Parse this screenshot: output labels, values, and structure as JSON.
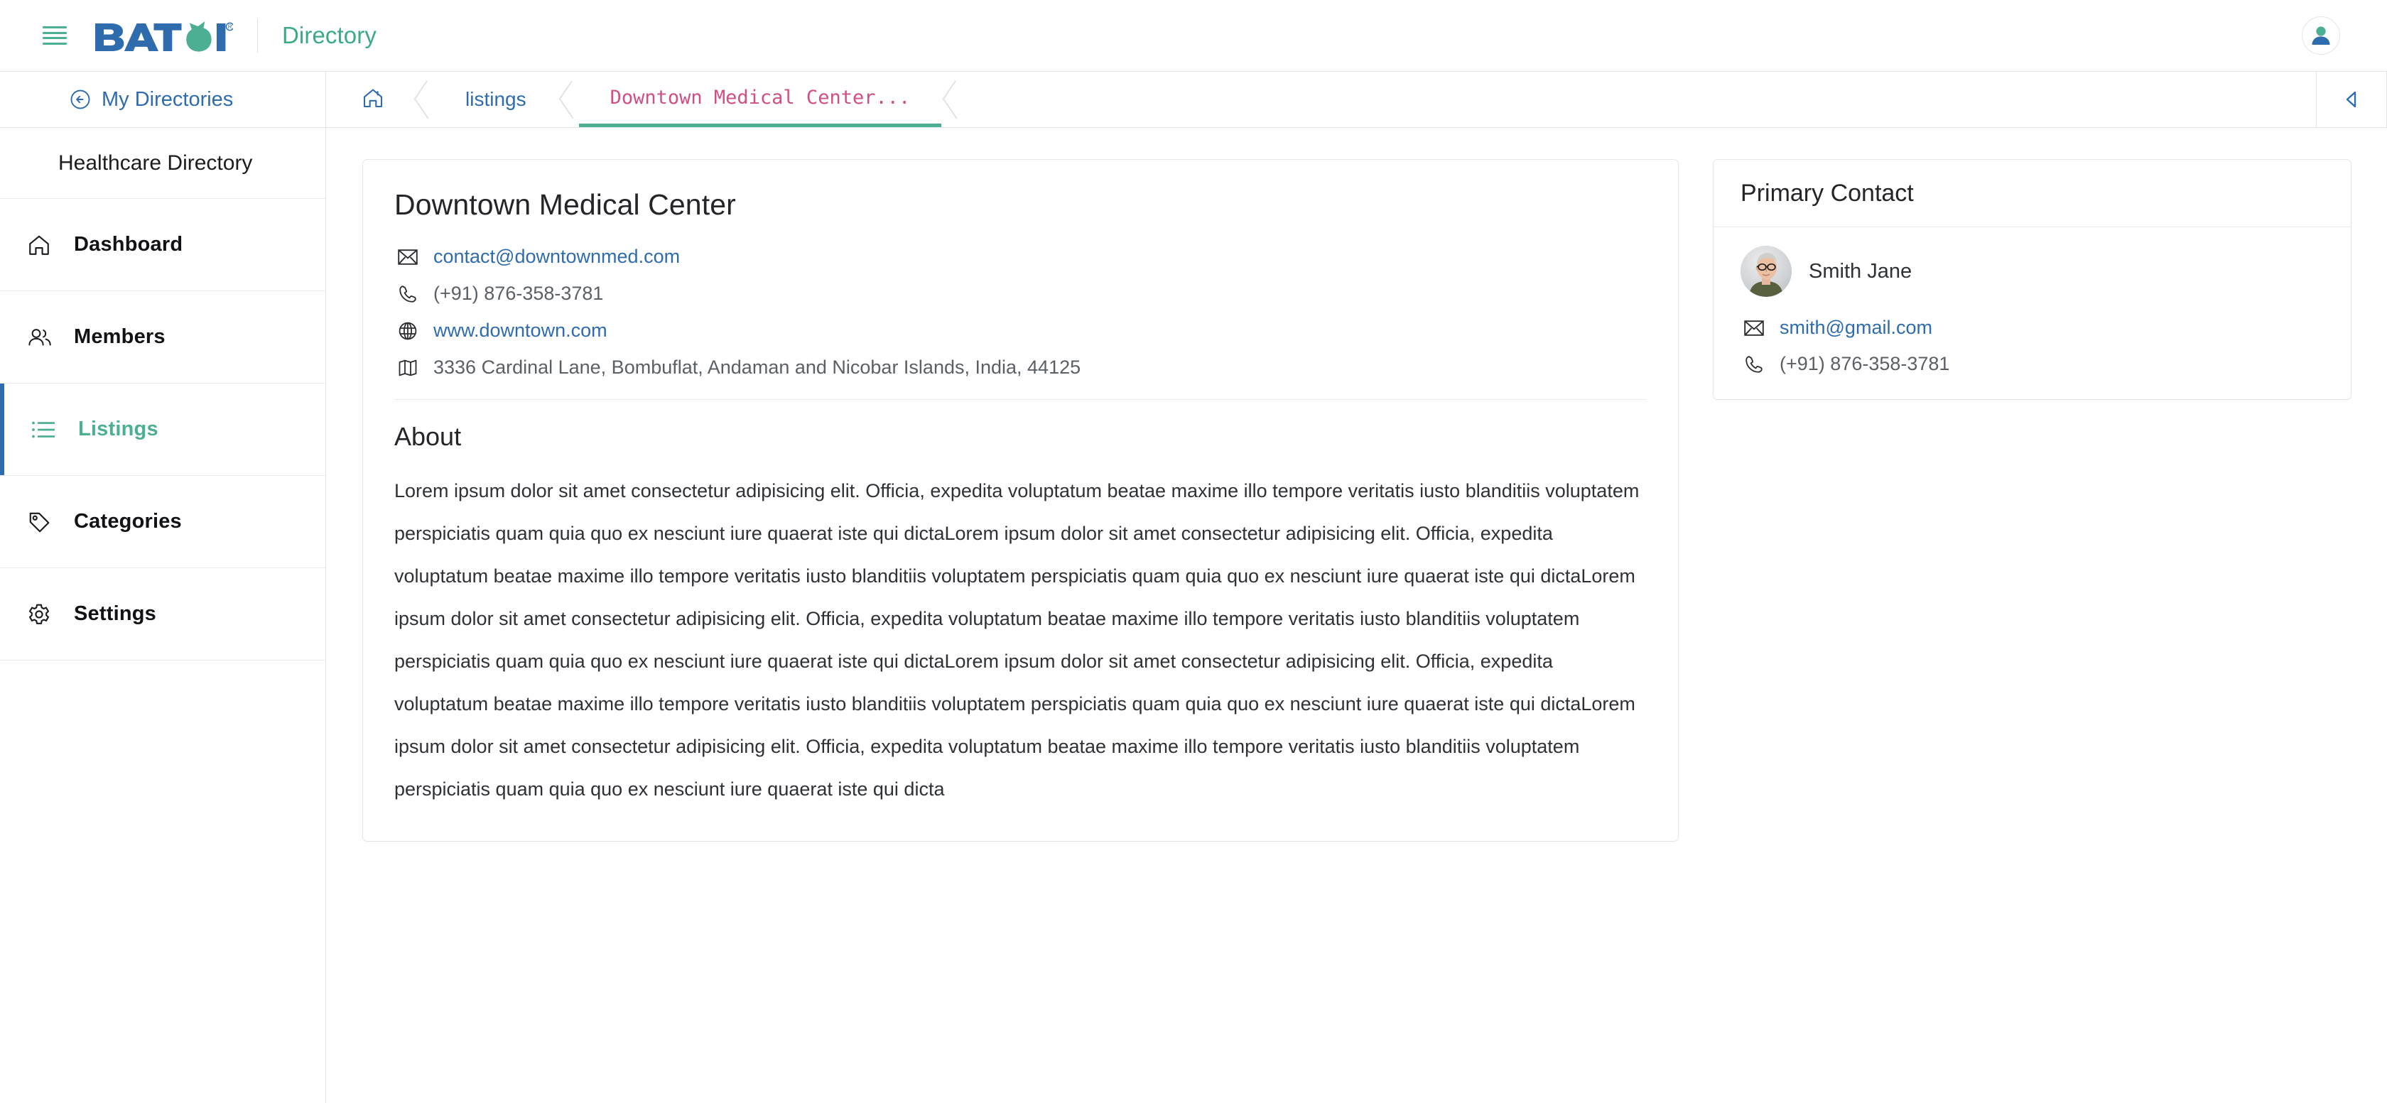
{
  "topbar": {
    "menu_icon": "hamburger-icon",
    "logo_text": "BATOI",
    "logo_trademark": "®",
    "app_name": "Directory",
    "user_icon": "user-avatar-icon"
  },
  "breadcrumb_bar": {
    "back_link": {
      "label": "My Directories",
      "icon": "circle-arrow-left-icon"
    },
    "items": [
      {
        "label": "",
        "icon": "home-icon",
        "active": false
      },
      {
        "label": "listings",
        "icon": "",
        "active": false
      },
      {
        "label": "Downtown Medical Center...",
        "icon": "",
        "active": true
      }
    ],
    "collapse_button_icon": "caret-left-icon"
  },
  "sidebar": {
    "directory_title": "Healthcare Directory",
    "items": [
      {
        "label": "Dashboard",
        "icon": "home-icon",
        "active": false
      },
      {
        "label": "Members",
        "icon": "users-icon",
        "active": false
      },
      {
        "label": "Listings",
        "icon": "list-icon",
        "active": true
      },
      {
        "label": "Categories",
        "icon": "tag-icon",
        "active": false
      },
      {
        "label": "Settings",
        "icon": "gear-icon",
        "active": false
      }
    ]
  },
  "listing": {
    "title": "Downtown Medical Center",
    "email": "contact@downtownmed.com",
    "phone": "(+91) 876-358-3781",
    "website": "www.downtown.com",
    "address": "3336 Cardinal Lane, Bombuflat, Andaman and Nicobar Islands, India, 44125",
    "about_heading": "About",
    "about_text": "Lorem ipsum dolor sit amet consectetur adipisicing elit. Officia, expedita voluptatum beatae maxime illo tempore veritatis iusto blanditiis voluptatem perspiciatis quam quia quo ex nesciunt iure quaerat iste qui dictaLorem ipsum dolor sit amet consectetur adipisicing elit. Officia, expedita voluptatum beatae maxime illo tempore veritatis iusto blanditiis voluptatem perspiciatis quam quia quo ex nesciunt iure quaerat iste qui dictaLorem ipsum dolor sit amet consectetur adipisicing elit. Officia, expedita voluptatum beatae maxime illo tempore veritatis iusto blanditiis voluptatem perspiciatis quam quia quo ex nesciunt iure quaerat iste qui dictaLorem ipsum dolor sit amet consectetur adipisicing elit. Officia, expedita voluptatum beatae maxime illo tempore veritatis iusto blanditiis voluptatem perspiciatis quam quia quo ex nesciunt iure quaerat iste qui dictaLorem ipsum dolor sit amet consectetur adipisicing elit. Officia, expedita voluptatum beatae maxime illo tempore veritatis iusto blanditiis voluptatem perspiciatis quam quia quo ex nesciunt iure quaerat iste qui dicta"
  },
  "primary_contact": {
    "heading": "Primary Contact",
    "name": "Smith Jane",
    "email": "smith@gmail.com",
    "phone": "(+91) 876-358-3781",
    "avatar": "person-photo"
  },
  "colors": {
    "brand_blue": "#2f6cad",
    "brand_green": "#3bab83",
    "accent_green": "#4cae92",
    "active_crumb_pink": "#d04f87",
    "link_blue": "#2f6cad",
    "text_dark": "#232528",
    "text_muted": "#5b6066",
    "border": "#e3e6ea"
  }
}
